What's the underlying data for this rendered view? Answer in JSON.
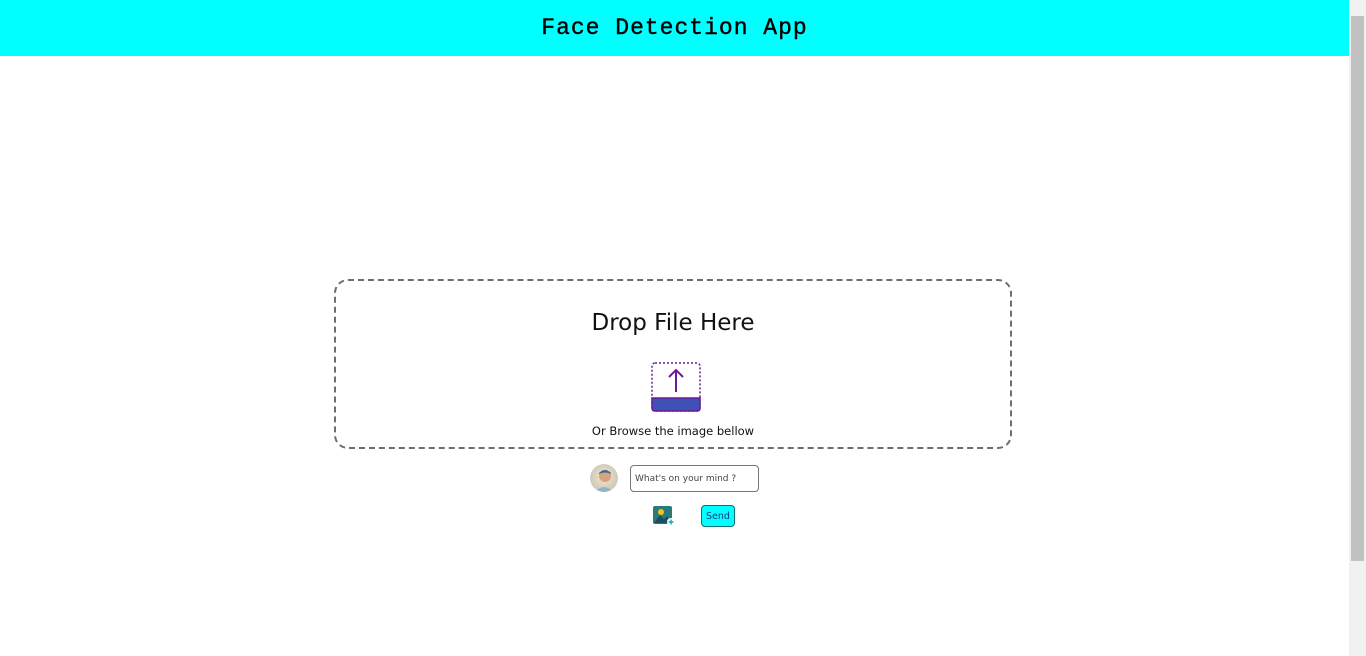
{
  "header": {
    "title": "Face Detection App"
  },
  "dropzone": {
    "title": "Drop File Here",
    "browse_text": "Or Browse the image bellow",
    "upload_icon": "upload-arrow-icon"
  },
  "composer": {
    "avatar_icon": "user-avatar",
    "input_placeholder": "What's on your mind ?",
    "input_value": "",
    "photo_icon": "add-image-icon",
    "send_label": "Send"
  },
  "colors": {
    "header_bg": "#00ffff",
    "upload_icon_purple": "#6a1b9a",
    "upload_icon_fill": "#3f51b5",
    "send_bg": "#00ffff"
  }
}
